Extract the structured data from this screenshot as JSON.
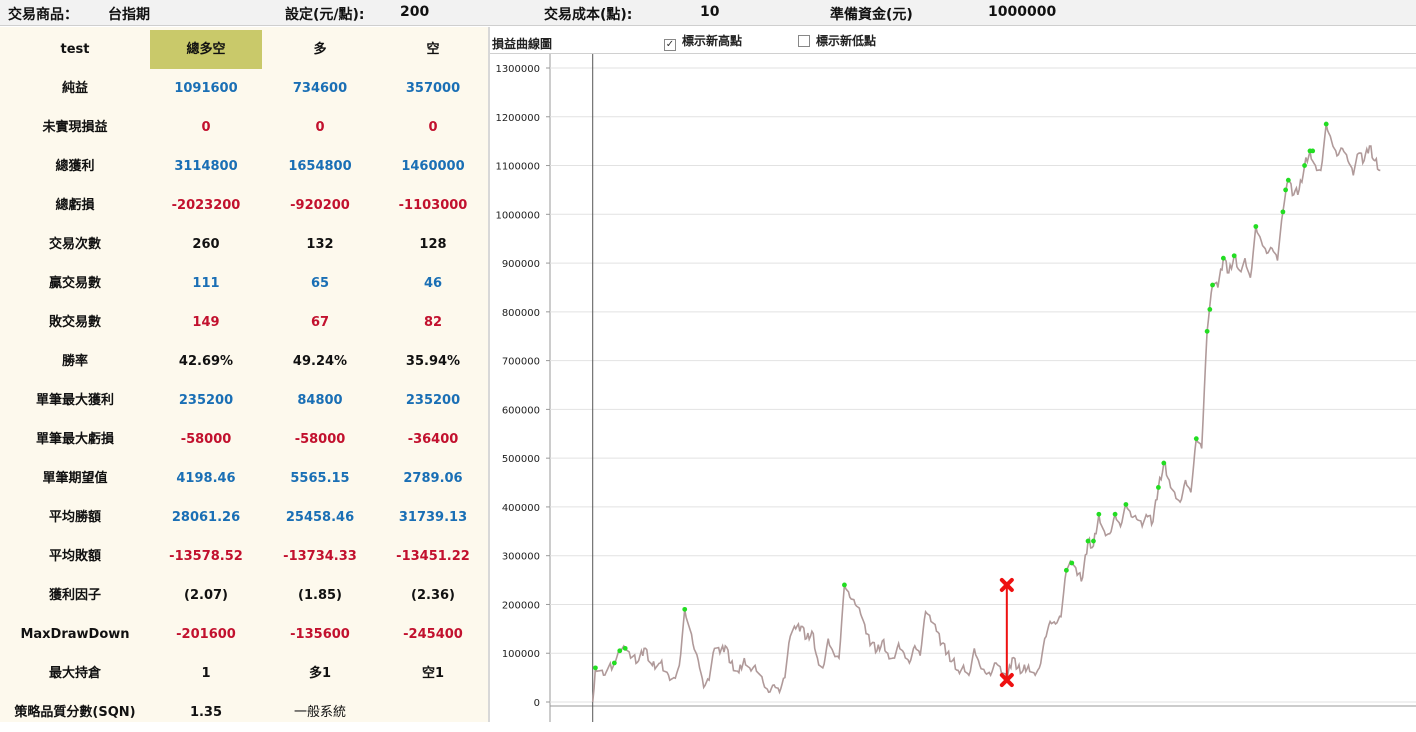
{
  "top": {
    "product_label": "交易商品：",
    "product_value": "台指期",
    "setting_label": "設定(元/點):",
    "setting_value": "200",
    "cost_label": "交易成本(點):",
    "cost_value": "10",
    "capital_label": "準備資金(元)",
    "capital_value": "1000000"
  },
  "stats": {
    "header": [
      "test",
      "總多空",
      "多",
      "空"
    ],
    "rows": [
      [
        "純益",
        "1091600",
        "734600",
        "357000"
      ],
      [
        "未實現損益",
        "0",
        "0",
        "0"
      ],
      [
        "總獲利",
        "3114800",
        "1654800",
        "1460000"
      ],
      [
        "總虧損",
        "-2023200",
        "-920200",
        "-1103000"
      ],
      [
        "交易次數",
        "260",
        "132",
        "128"
      ],
      [
        "贏交易數",
        "111",
        "65",
        "46"
      ],
      [
        "敗交易數",
        "149",
        "67",
        "82"
      ],
      [
        "勝率",
        "42.69%",
        "49.24%",
        "35.94%"
      ],
      [
        "單筆最大獲利",
        "235200",
        "84800",
        "235200"
      ],
      [
        "單筆最大虧損",
        "-58000",
        "-58000",
        "-36400"
      ],
      [
        "單筆期望值",
        "4198.46",
        "5565.15",
        "2789.06"
      ],
      [
        "平均勝額",
        "28061.26",
        "25458.46",
        "31739.13"
      ],
      [
        "平均敗額",
        "-13578.52",
        "-13734.33",
        "-13451.22"
      ],
      [
        "獲利因子",
        "(2.07)",
        "(1.85)",
        "(2.36)"
      ],
      [
        "MaxDrawDown",
        "-201600",
        "-135600",
        "-245400"
      ],
      [
        "最大持倉",
        "1",
        "多1",
        "空1"
      ],
      [
        "策略品質分數(SQN)",
        "1.35",
        "一般系統",
        ""
      ]
    ],
    "row_colors": [
      "pos",
      "neg",
      "pos",
      "neg",
      "blk",
      "pos",
      "neg",
      "blk",
      "pos",
      "neg",
      "pos",
      "pos",
      "neg",
      "blk",
      "neg",
      "blk",
      "blk"
    ]
  },
  "chart_panel": {
    "title": "損益曲線圖",
    "show_new_high_label": "標示新高點",
    "show_new_high_checked": true,
    "show_new_low_label": "標示新低點",
    "show_new_low_checked": false
  },
  "chart_data": {
    "type": "line",
    "title": "損益曲線圖",
    "xlabel": "",
    "ylabel": "",
    "ylim": [
      0,
      1300000
    ],
    "yticks": [
      0,
      100000,
      200000,
      300000,
      400000,
      500000,
      600000,
      700000,
      800000,
      900000,
      1000000,
      1100000,
      1200000,
      1300000
    ],
    "grid": true,
    "line_color": "#b09a9a",
    "new_high_color": "#22dd22",
    "drawdown_color": "#ee1111",
    "keypoints": [
      [
        1,
        0
      ],
      [
        2,
        70000
      ],
      [
        5,
        55000
      ],
      [
        9,
        80000
      ],
      [
        11,
        105000
      ],
      [
        13,
        110000
      ],
      [
        15,
        90000
      ],
      [
        18,
        85000
      ],
      [
        20,
        110000
      ],
      [
        23,
        75000
      ],
      [
        26,
        80000
      ],
      [
        29,
        55000
      ],
      [
        31,
        50000
      ],
      [
        33,
        75000
      ],
      [
        35,
        190000
      ],
      [
        38,
        120000
      ],
      [
        40,
        85000
      ],
      [
        42,
        30000
      ],
      [
        44,
        45000
      ],
      [
        46,
        110000
      ],
      [
        48,
        100000
      ],
      [
        50,
        115000
      ],
      [
        52,
        80000
      ],
      [
        55,
        60000
      ],
      [
        57,
        90000
      ],
      [
        59,
        70000
      ],
      [
        61,
        75000
      ],
      [
        64,
        40000
      ],
      [
        66,
        20000
      ],
      [
        68,
        35000
      ],
      [
        70,
        20000
      ],
      [
        72,
        50000
      ],
      [
        74,
        135000
      ],
      [
        76,
        150000
      ],
      [
        78,
        155000
      ],
      [
        80,
        130000
      ],
      [
        82,
        145000
      ],
      [
        84,
        90000
      ],
      [
        86,
        70000
      ],
      [
        88,
        130000
      ],
      [
        90,
        100000
      ],
      [
        92,
        90000
      ],
      [
        94,
        240000
      ],
      [
        96,
        215000
      ],
      [
        98,
        200000
      ],
      [
        100,
        180000
      ],
      [
        102,
        140000
      ],
      [
        104,
        120000
      ],
      [
        106,
        105000
      ],
      [
        108,
        125000
      ],
      [
        110,
        100000
      ],
      [
        112,
        90000
      ],
      [
        114,
        120000
      ],
      [
        116,
        100000
      ],
      [
        118,
        80000
      ],
      [
        120,
        115000
      ],
      [
        122,
        95000
      ],
      [
        124,
        185000
      ],
      [
        126,
        165000
      ],
      [
        128,
        145000
      ],
      [
        130,
        120000
      ],
      [
        132,
        100000
      ],
      [
        134,
        85000
      ],
      [
        136,
        65000
      ],
      [
        138,
        75000
      ],
      [
        140,
        55000
      ],
      [
        142,
        110000
      ],
      [
        144,
        75000
      ],
      [
        146,
        60000
      ],
      [
        148,
        55000
      ],
      [
        150,
        80000
      ],
      [
        152,
        60000
      ],
      [
        154,
        45000
      ],
      [
        156,
        90000
      ],
      [
        158,
        70000
      ],
      [
        160,
        65000
      ],
      [
        162,
        75000
      ],
      [
        164,
        60000
      ],
      [
        166,
        70000
      ],
      [
        168,
        130000
      ],
      [
        170,
        165000
      ],
      [
        172,
        160000
      ],
      [
        174,
        175000
      ],
      [
        176,
        270000
      ],
      [
        178,
        285000
      ],
      [
        180,
        260000
      ],
      [
        182,
        255000
      ],
      [
        184,
        330000
      ],
      [
        186,
        320000
      ],
      [
        188,
        385000
      ],
      [
        190,
        350000
      ],
      [
        192,
        345000
      ],
      [
        194,
        385000
      ],
      [
        196,
        360000
      ],
      [
        198,
        405000
      ],
      [
        200,
        380000
      ],
      [
        202,
        375000
      ],
      [
        204,
        360000
      ],
      [
        206,
        380000
      ],
      [
        208,
        370000
      ],
      [
        210,
        440000
      ],
      [
        212,
        490000
      ],
      [
        214,
        455000
      ],
      [
        216,
        430000
      ],
      [
        218,
        410000
      ],
      [
        220,
        455000
      ],
      [
        222,
        430000
      ],
      [
        224,
        540000
      ],
      [
        226,
        520000
      ],
      [
        228,
        760000
      ],
      [
        230,
        855000
      ],
      [
        232,
        850000
      ],
      [
        234,
        910000
      ],
      [
        236,
        880000
      ],
      [
        238,
        915000
      ],
      [
        240,
        885000
      ],
      [
        242,
        910000
      ],
      [
        244,
        870000
      ],
      [
        246,
        975000
      ],
      [
        248,
        945000
      ],
      [
        250,
        920000
      ],
      [
        252,
        930000
      ],
      [
        254,
        905000
      ],
      [
        256,
        1005000
      ],
      [
        258,
        1070000
      ],
      [
        260,
        1040000
      ],
      [
        262,
        1050000
      ],
      [
        264,
        1100000
      ],
      [
        266,
        1130000
      ],
      [
        268,
        1100000
      ],
      [
        270,
        1090000
      ],
      [
        272,
        1185000
      ],
      [
        274,
        1150000
      ],
      [
        276,
        1120000
      ],
      [
        278,
        1135000
      ],
      [
        280,
        1110000
      ],
      [
        282,
        1080000
      ],
      [
        284,
        1125000
      ],
      [
        286,
        1110000
      ],
      [
        288,
        1140000
      ],
      [
        290,
        1110000
      ],
      [
        292,
        1090000
      ]
    ],
    "new_highs": [
      [
        2,
        70000
      ],
      [
        9,
        80000
      ],
      [
        11,
        105000
      ],
      [
        13,
        110000
      ],
      [
        35,
        190000
      ],
      [
        94,
        240000
      ],
      [
        176,
        270000
      ],
      [
        178,
        285000
      ],
      [
        184,
        330000
      ],
      [
        186,
        330000
      ],
      [
        188,
        385000
      ],
      [
        194,
        385000
      ],
      [
        198,
        405000
      ],
      [
        210,
        440000
      ],
      [
        212,
        490000
      ],
      [
        224,
        540000
      ],
      [
        228,
        760000
      ],
      [
        229,
        805000
      ],
      [
        230,
        855000
      ],
      [
        234,
        910000
      ],
      [
        238,
        915000
      ],
      [
        246,
        975000
      ],
      [
        256,
        1005000
      ],
      [
        257,
        1050000
      ],
      [
        258,
        1070000
      ],
      [
        264,
        1100000
      ],
      [
        266,
        1130000
      ],
      [
        267,
        1130000
      ],
      [
        272,
        1185000
      ]
    ],
    "max_drawdown": {
      "x": 154,
      "from": 240000,
      "to": 45000
    },
    "x_range": [
      0,
      300
    ],
    "y_axis_x": 1
  }
}
